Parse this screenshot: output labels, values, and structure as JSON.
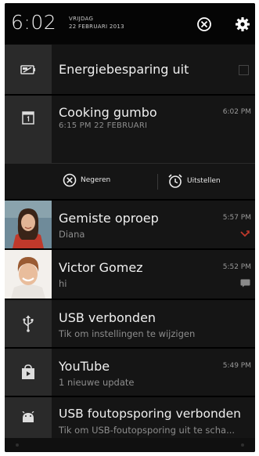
{
  "status": {
    "time": "6:02",
    "day": "VRIJDAG",
    "date": "22 FEBRUARI 2013"
  },
  "notifications": {
    "power": {
      "title": "Energiebesparing uit",
      "icon": "battery-saver-icon"
    },
    "event": {
      "title": "Cooking gumbo",
      "subtitle": "6:15 PM 22 FEBRUARI",
      "time": "6:02 PM",
      "actions": {
        "dismiss": "Negeren",
        "snooze": "Uitstellen"
      }
    },
    "missed_call": {
      "title": "Gemiste oproep",
      "subtitle": "Diana",
      "time": "5:57 PM"
    },
    "message": {
      "title": "Victor Gomez",
      "subtitle": "hi",
      "time": "5:52 PM"
    },
    "usb": {
      "title": "USB verbonden",
      "subtitle": "Tik om instellingen te wijzigen"
    },
    "youtube": {
      "title": "YouTube",
      "subtitle": "1 nieuwe update",
      "time": "5:49 PM"
    },
    "usb_debug": {
      "title": "USB foutopsporing verbonden",
      "subtitle": "Tik om USB-foutopsporing uit te scha..."
    }
  },
  "colors": {
    "background": "#0b0b0b",
    "row": "#151515",
    "icon_column": "#2a2a2a",
    "missed_call_red": "#c0392b"
  }
}
